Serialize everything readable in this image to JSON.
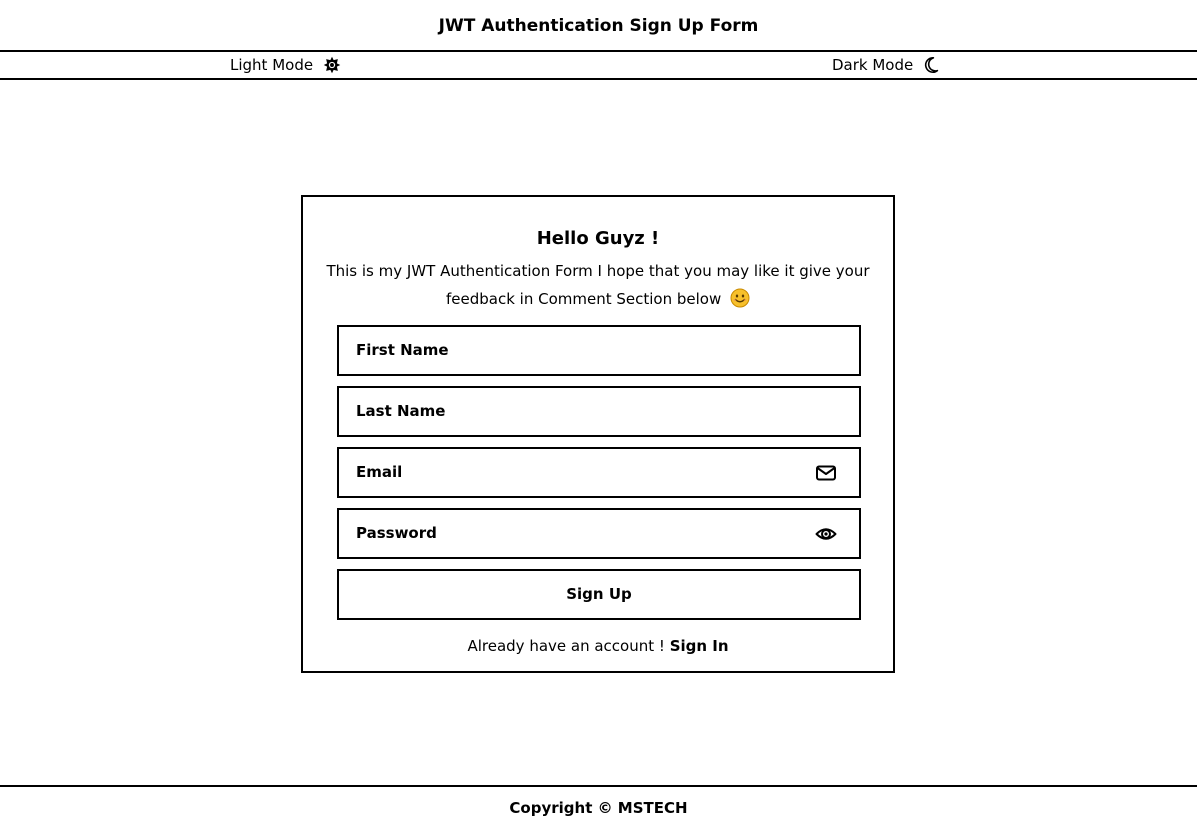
{
  "header": {
    "title": "JWT Authentication Sign Up Form"
  },
  "mode_bar": {
    "light_label": "Light Mode",
    "light_icon": "sun-icon",
    "dark_label": "Dark Mode",
    "dark_icon": "moon-icon"
  },
  "form": {
    "title": "Hello Guyz !",
    "description": "This is my JWT Authentication Form I hope that you may like it give your feedback in Comment Section below",
    "description_icon": "smiley-icon",
    "fields": [
      {
        "placeholder": "First Name"
      },
      {
        "placeholder": "Last Name"
      },
      {
        "placeholder": "Email",
        "icon": "envelope-icon"
      },
      {
        "placeholder": "Password",
        "icon": "eye-icon"
      }
    ],
    "submit_label": "Sign Up",
    "signin_prompt": "Already have an account !",
    "signin_link": "Sign In"
  },
  "footer": {
    "copyright": "Copyright © MSTECH"
  },
  "colors": {
    "background": "#ffffff",
    "border": "#000000",
    "smiley": "#f7c02b"
  }
}
